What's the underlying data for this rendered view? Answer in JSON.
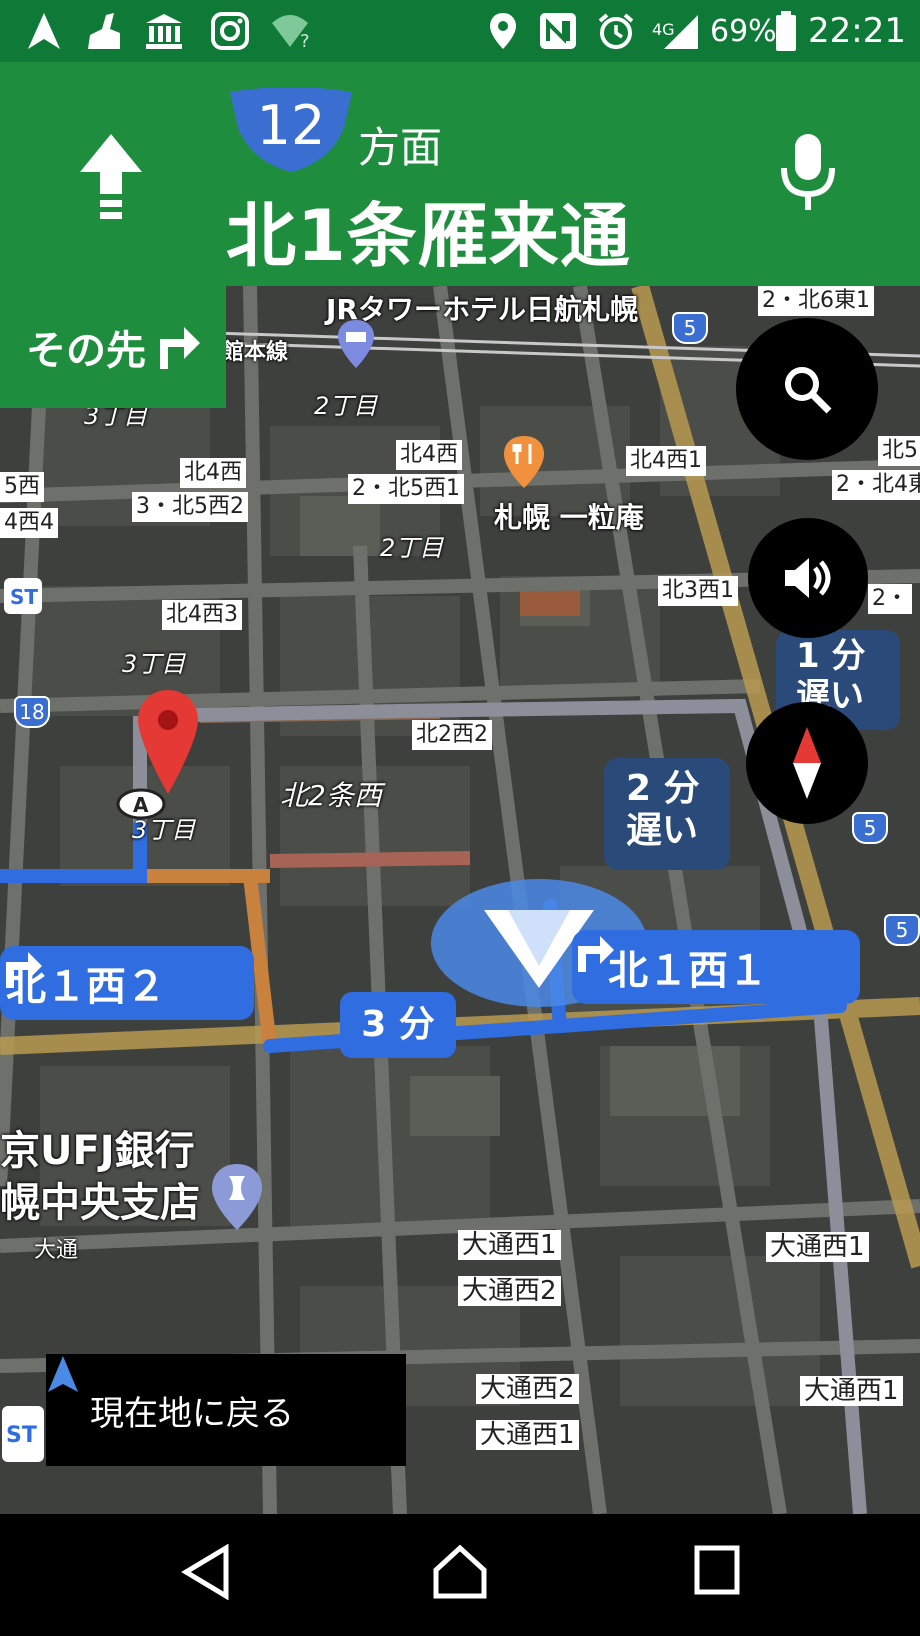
{
  "status_bar": {
    "network": "4G",
    "battery": "69%",
    "time": "22:21",
    "icons_left": [
      "navigation-icon",
      "broom-icon",
      "bank-icon",
      "instagram-icon",
      "wifi-unknown-icon"
    ],
    "icons_right": [
      "location-pin-icon",
      "nfc-icon",
      "alarm-icon",
      "signal-icon",
      "battery-icon"
    ]
  },
  "header": {
    "maneuver": "straight-arrow-icon",
    "route_number": "12",
    "direction_suffix": "方面",
    "street": "北1条雁来通",
    "mic": "microphone-icon"
  },
  "then_panel": {
    "label": "その先",
    "icon": "turn-right-icon"
  },
  "map": {
    "labels": {
      "hotel": "JRタワーホテル日航札幌",
      "line": "館本線",
      "restaurant": "札幌 一粒庵",
      "bank_line1": "京UFJ銀行",
      "bank_line2": "幌中央支店",
      "district_n2": "北2条西",
      "chome_a": "3丁目",
      "chome_b": "2丁目",
      "chome_c": "2丁目",
      "chome_d": "3丁目",
      "chome_e": "3丁目",
      "odori": "大通"
    },
    "intersections": {
      "n6e1": "2・北6東1",
      "n5": "北5",
      "n5w": "5西",
      "n4w_short": "4西4",
      "n4w": "北4西",
      "n4w_b": "北4西",
      "n3n5w2": "3・北5西2",
      "n2n5w1": "2・北5西1",
      "n4w1": "北4西1",
      "n2n4": "2・北4東",
      "n4w3": "北4西3",
      "n3w1": "北3西1",
      "n2_": "2・",
      "n2w2": "北2西2",
      "odori_w1_a": "大通西1",
      "odori_w2_a": "大通西2",
      "odori_w1_b": "大通西1",
      "odori_w2_b": "大通西2",
      "odori_w1_c": "大通西1",
      "odori_w1_d": "大通西1"
    },
    "highway_shields": [
      "5",
      "18",
      "5",
      "5"
    ],
    "delay_callout_1": {
      "line1": "1 分",
      "line2": "遅い"
    },
    "delay_callout_2": {
      "line1": "2 分",
      "line2": "遅い"
    },
    "turn_left_tag": "北１西２",
    "turn_right_tag": "北１西１",
    "time_tag": "3 分",
    "recenter_label": "現在地に戻る"
  },
  "fab": {
    "search": "search-icon",
    "sound": "volume-icon",
    "compass": "compass-icon"
  },
  "navbar": {
    "back": "back-icon",
    "home": "home-icon",
    "recents": "recents-icon"
  },
  "colors": {
    "header_green": "#1e8e3e",
    "status_green": "#0f7a37",
    "route_blue": "#2f6de0",
    "delay_blue": "#2a4a79",
    "shield_blue": "#3a6fd1",
    "pin_red": "#e53935",
    "map_dark": "#3b3d3a"
  }
}
